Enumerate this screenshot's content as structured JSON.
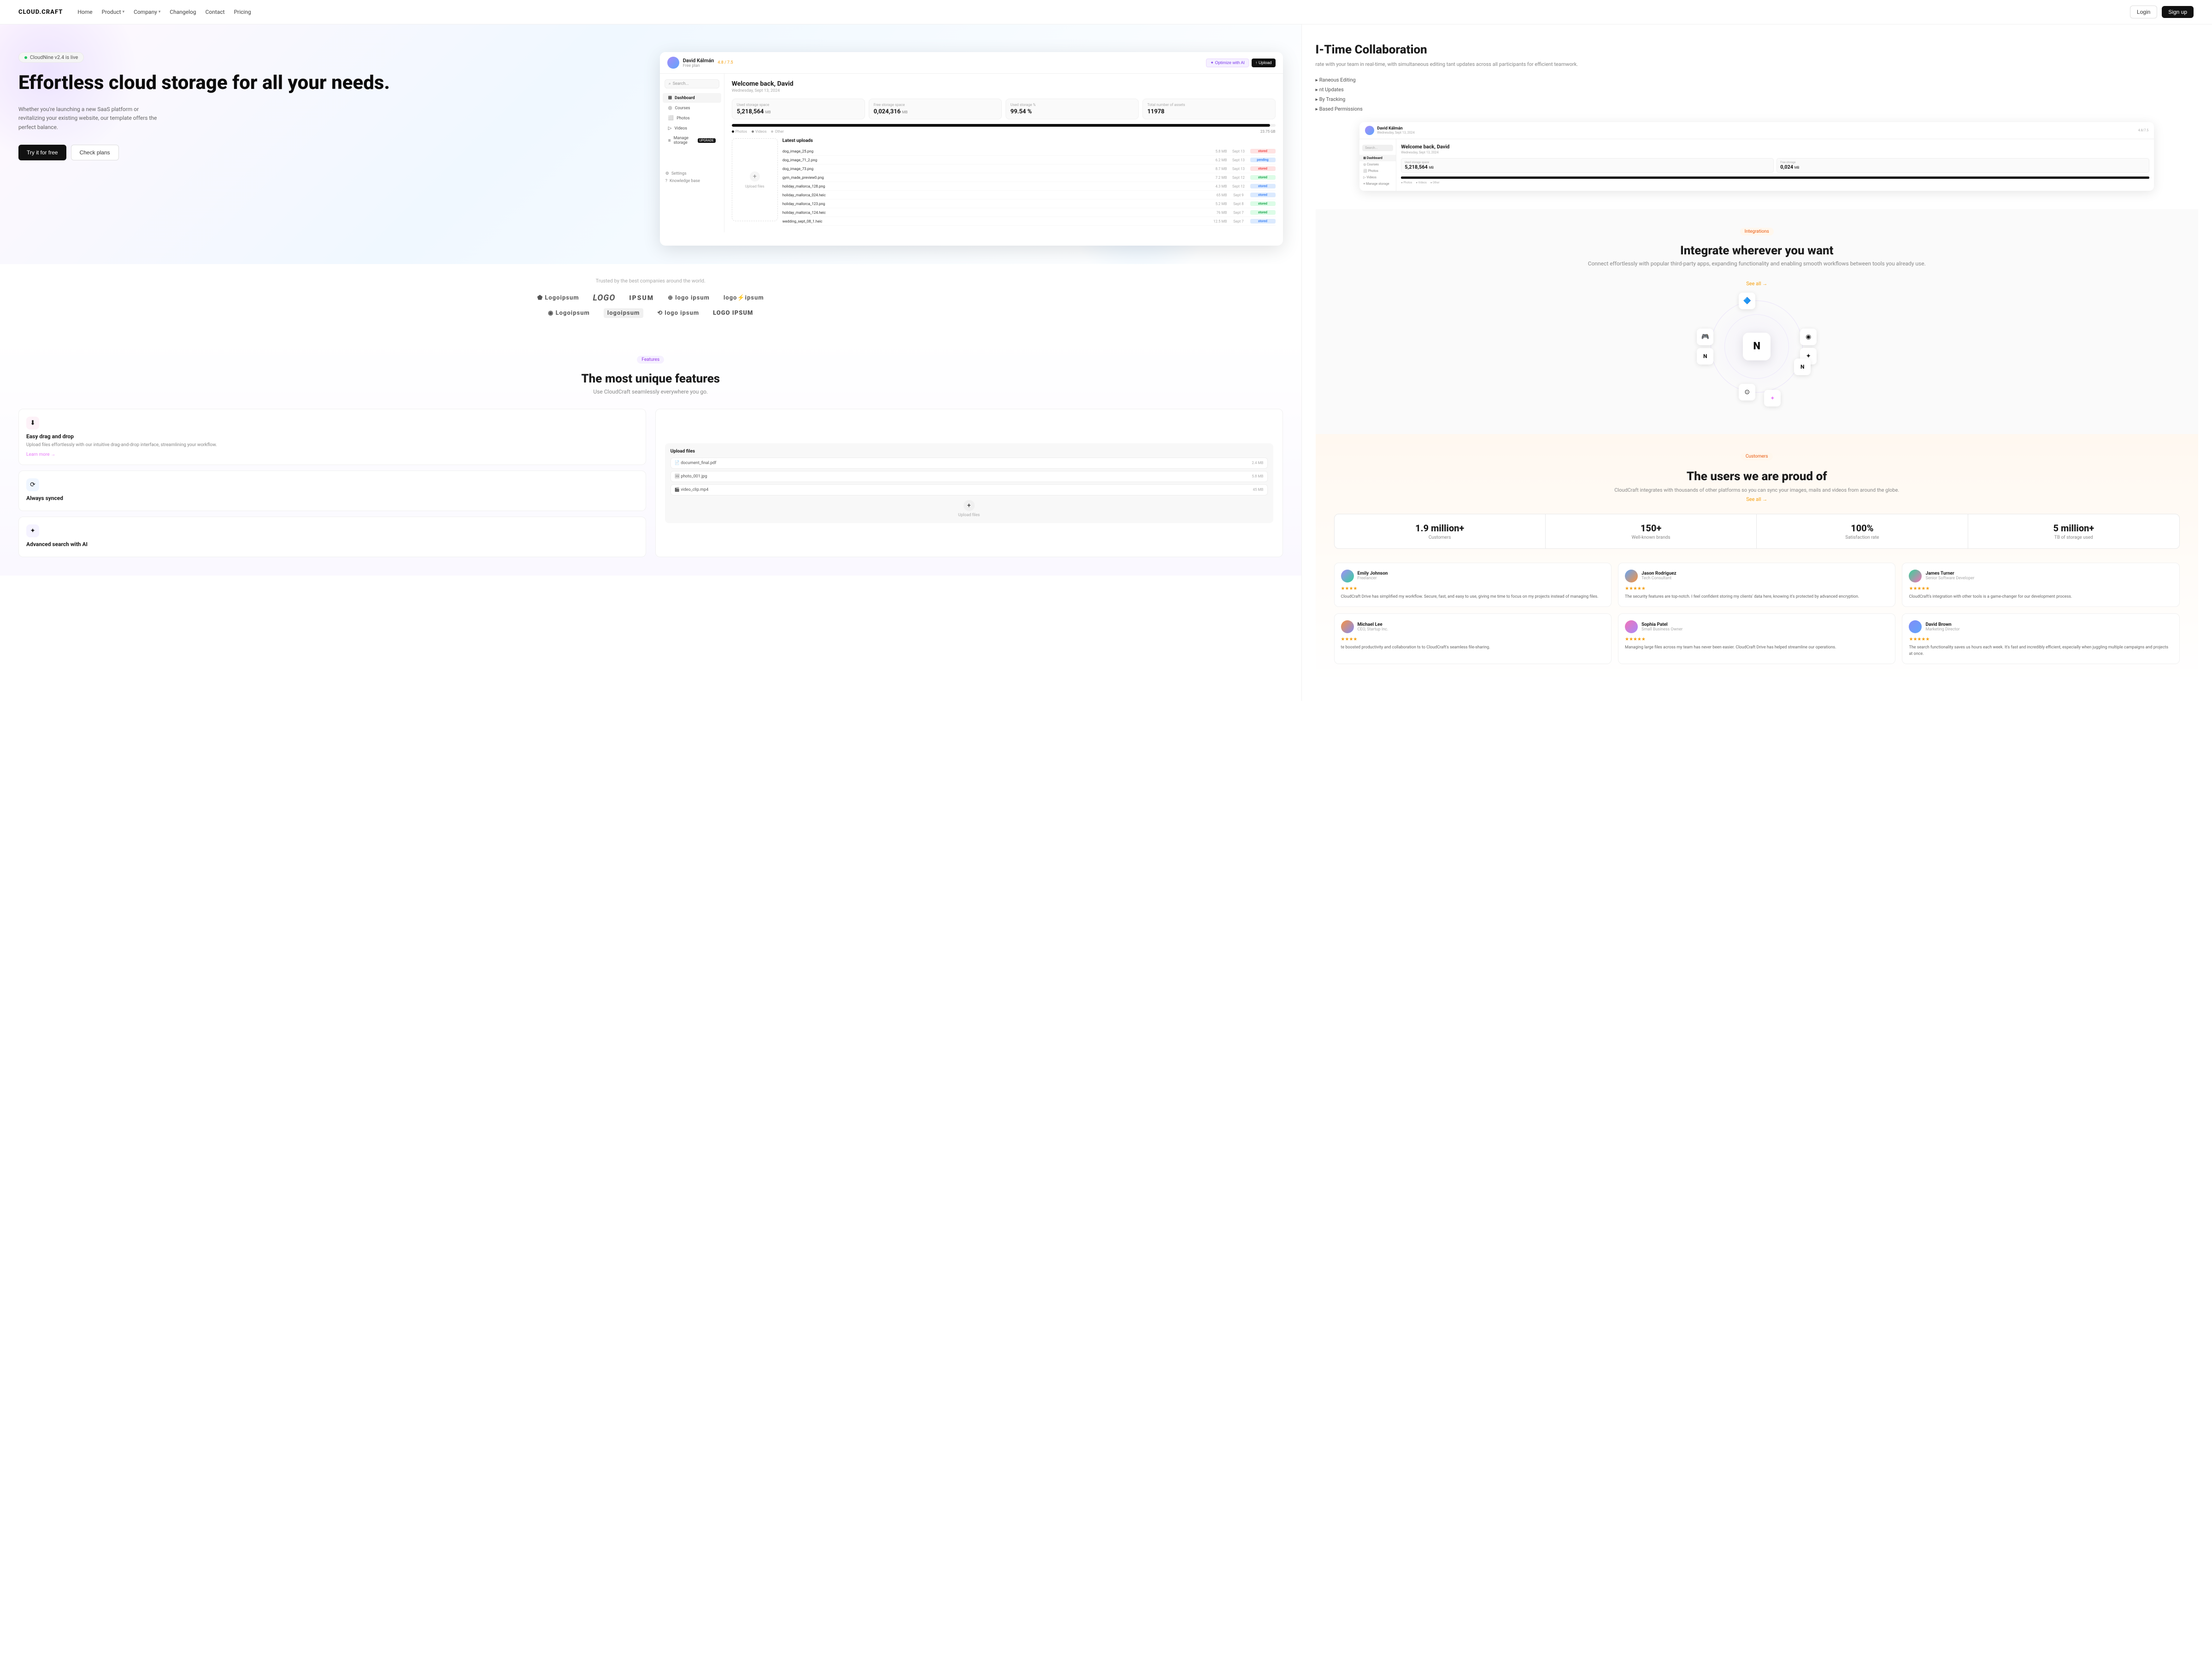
{
  "site": {
    "logo": "CLOUD.CRAFT",
    "nav": {
      "home": "Home",
      "product": "Product",
      "company": "Company",
      "changelog": "Changelog",
      "contact": "Contact",
      "pricing": "Pricing"
    },
    "login": "Login",
    "signup": "Sign up"
  },
  "hero": {
    "badge": "CloudNine v2.4 is live",
    "title": "Effortless cloud storage for all your needs.",
    "description": "Whether you're launching a new SaaS platform or revitalizing your existing website, our template offers the perfect balance.",
    "cta_primary": "Try it for free",
    "cta_secondary": "Check plans"
  },
  "dashboard": {
    "user": {
      "name": "David Kálmán",
      "sub": "Free plan",
      "rating": "4.8 / 7.5"
    },
    "welcome": "Welcome back, David",
    "date": "Wednesday, Sept 13, 2024",
    "btn_ai": "✦ Optimize with AI",
    "btn_upload": "↑ Upload",
    "search_placeholder": "Search...",
    "nav": [
      "Dashboard",
      "Courses",
      "Photos",
      "Videos",
      "Manage storage"
    ],
    "nav_icons": [
      "⊞",
      "◎",
      "⬜",
      "▷",
      "≡"
    ],
    "settings": "Settings",
    "knowledge_base": "Knowledge base",
    "stats": [
      {
        "label": "Used storage space",
        "value": "5,218,564",
        "unit": "MB"
      },
      {
        "label": "Free storage space",
        "value": "0,024,316",
        "unit": "MB"
      },
      {
        "label": "Used storage %",
        "value": "99.54 %",
        "unit": ""
      },
      {
        "label": "Total number of assets",
        "value": "11978",
        "unit": ""
      }
    ],
    "storage_size": "23.75 GB",
    "storage_labels": [
      "Photos",
      "Videos",
      "Other"
    ],
    "uploads_title": "Latest uploads",
    "uploads": [
      {
        "name": "dog_image_25.png",
        "size": "5.8 MB",
        "date": "Sept 13",
        "status": "stored",
        "type": "red"
      },
      {
        "name": "dog_image_71_2.png",
        "size": "6.2 MB",
        "date": "Sept 13",
        "status": "pending",
        "type": "blue"
      },
      {
        "name": "dog_image_73.png",
        "size": "8.7 MB",
        "date": "Sept 13",
        "status": "stored",
        "type": "red"
      },
      {
        "name": "gym_made_preview0.png",
        "size": "7.2 MB",
        "date": "Sept 12",
        "status": "stored",
        "type": "green"
      },
      {
        "name": "holiday_mallorca_128.png",
        "size": "4.3 MB",
        "date": "Sept 12",
        "status": "stored",
        "type": "blue"
      },
      {
        "name": "holiday_mallorca_024.heic",
        "size": "65 MB",
        "date": "Sept 9",
        "status": "stored",
        "type": "blue"
      },
      {
        "name": "holiday_mallorca_123.png",
        "size": "5.2 MB",
        "date": "Sept 8",
        "status": "stored",
        "type": "green"
      },
      {
        "name": "holiday_mallorca_124.heic",
        "size": "76 MB",
        "date": "Sept 7",
        "status": "stored",
        "type": "green"
      },
      {
        "name": "wedding_sept_08_1.heic",
        "size": "12.5 MB",
        "date": "Sept 7",
        "status": "stored",
        "type": "blue"
      }
    ],
    "upload_zone": "Upload files"
  },
  "trusted": {
    "title": "Trusted by the best companies around the world.",
    "logos": [
      "Logoipsum",
      "LOGO",
      "IPSUM",
      "logo ipsum",
      "logo ipsum",
      "Logoipsum",
      "logoipsum",
      "logo ipsum",
      "LOGO IPSUM"
    ]
  },
  "features": {
    "tag": "Features",
    "title": "The most unique features",
    "subtitle": "Use CloudCraft seamlessly everywhere you go.",
    "items": [
      {
        "icon": "⬇",
        "title": "Easy drag and drop",
        "desc": "Upload files effortlessly with our intuitive drag-and-drop interface, streamlining your workflow.",
        "learn_more": "Learn more →"
      },
      {
        "icon": "⟳",
        "title": "Always synced",
        "desc": ""
      },
      {
        "icon": "✦",
        "title": "Advanced search with AI",
        "desc": ""
      }
    ]
  },
  "collaboration": {
    "title": "I-Time Collaboration",
    "description": "rate with your team in real-time, with simultaneous editing tant updates across all participants for efficient teamwork.",
    "features": [
      "Raneous Editing",
      "nt Updates",
      "By Tracking",
      "Based Permissions"
    ]
  },
  "integrations": {
    "tag": "Integrations",
    "title": "Integrate wherever you want",
    "description": "Connect effortlessly with popular third-party apps, expanding functionality and enabling smooth workflows between tools you already use.",
    "see_all": "See all →",
    "center_icon": "N"
  },
  "customers": {
    "tag": "Customers",
    "title": "The users we are proud of",
    "description": "CloudCraft integrates with thousands of other platforms so you can sync your images, mails and videos from around the globe.",
    "see_all": "See all →",
    "stats": [
      {
        "value": "1.9 million+",
        "label": "Customers"
      },
      {
        "value": "150+",
        "label": "Well-known brands"
      },
      {
        "value": "100%",
        "label": "Satisfaction rate"
      },
      {
        "value": "5 million+",
        "label": "TB of storage used"
      }
    ]
  },
  "testimonials": [
    {
      "name": "Emily Johnson",
      "role": "Freelancer",
      "stars": "★★★★",
      "text": "CloudCraft Drive has simplified my workflow. Secure, fast, and easy to use, giving me time to focus on my projects instead of managing files."
    },
    {
      "name": "Jason Rodriguez",
      "role": "Tech Consultant",
      "stars": "★★★★★",
      "text": "The security features are top-notch. I feel confident storing my clients' data here, knowing it's protected by advanced encryption."
    },
    {
      "name": "James Turner",
      "role": "Senior Software Developer",
      "stars": "★★★★★",
      "text": "CloudCraft's integration with other tools is a game-changer for our development process."
    },
    {
      "name": "Michael Lee",
      "role": "CEO, Startup Inc.",
      "stars": "★★★★",
      "text": "te boosted productivity and collaboration ts to CloudCraft's seamless file-sharing."
    },
    {
      "name": "Sophia Patel",
      "role": "Small Business Owner",
      "stars": "★★★★★",
      "text": "Managing large files across my team has never been easier. CloudCraft Drive has helped streamline our operations."
    },
    {
      "name": "David Brown",
      "role": "Marketing Director",
      "stars": "★★★★★",
      "text": "The search functionality saves us hours each week. It's fast and incredibly efficient, especially when juggling multiple campaigns and projects at once."
    }
  ],
  "colors": {
    "accent_purple": "#9333ea",
    "accent_pink": "#e879f9",
    "accent_yellow": "#f59e0b",
    "accent_blue": "#3b82f6",
    "accent_green": "#22c55e"
  }
}
